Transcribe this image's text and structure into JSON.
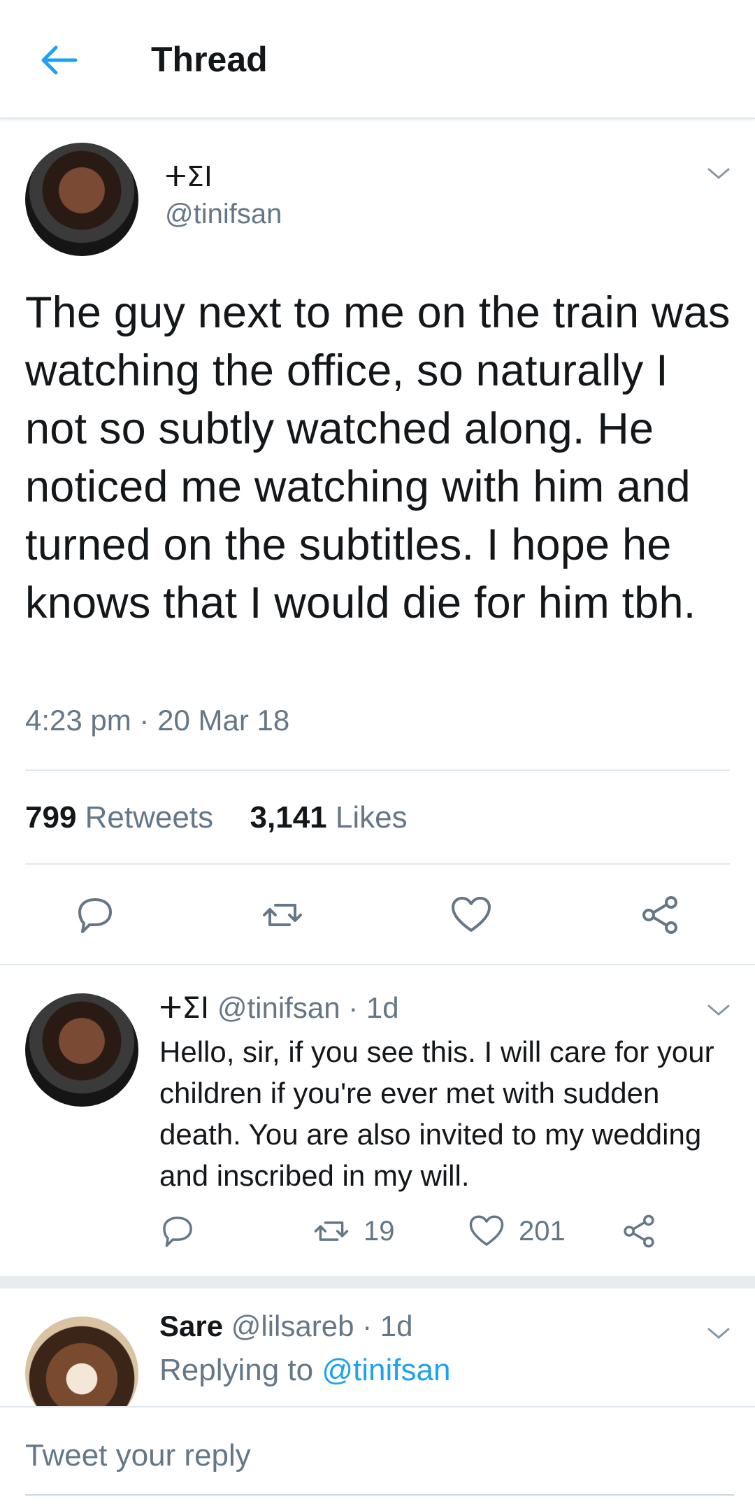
{
  "header": {
    "title": "Thread",
    "back_icon": "back-arrow-icon",
    "accent": "#1da1f2"
  },
  "main_tweet": {
    "display_name": "ⵜⵉⵏ",
    "handle": "@tinifsan",
    "text": "The guy next to me on the train was watching the office, so naturally I not so subtly watched along. He noticed me watching with him and turned on the subtitles. I hope he knows that I would die for him tbh.",
    "timestamp": "4:23 pm · 20 Mar 18",
    "retweets_count": "799",
    "retweets_label": "Retweets",
    "likes_count": "3,141",
    "likes_label": "Likes"
  },
  "reply_tweet": {
    "display_name": "ⵜⵉⵏ",
    "handle_time": "@tinifsan · 1d",
    "text": "Hello, sir, if you see this. I will care for your children if you're ever met with sudden death. You are also invited to my wedding and inscribed in my will.",
    "retweets": "19",
    "likes": "201"
  },
  "third_tweet": {
    "display_name": "Sare",
    "handle_time": "@lilsareb · 1d",
    "replying_label": "Replying to",
    "replying_handle": "@tinifsan"
  },
  "composer": {
    "placeholder": "Tweet your reply"
  }
}
